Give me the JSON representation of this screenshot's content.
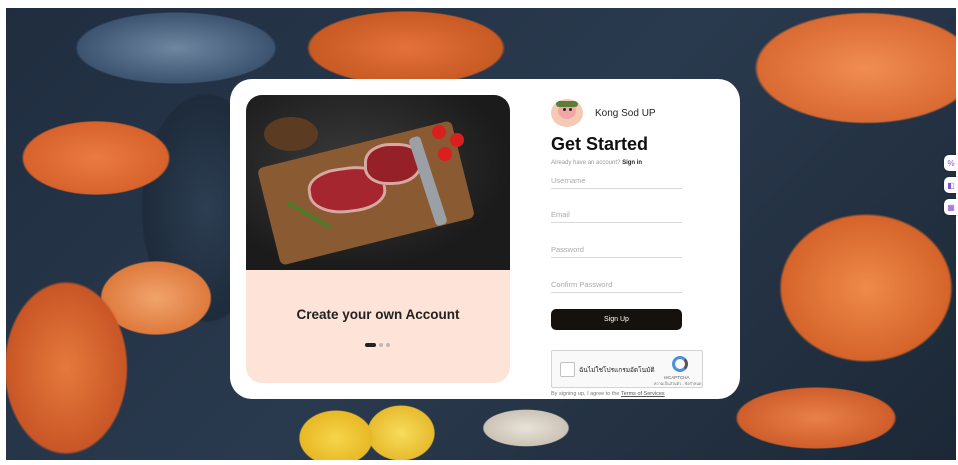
{
  "brand": {
    "name": "Kong Sod UP"
  },
  "slide": {
    "title": "Create your own Account",
    "dot_count": 3,
    "active_dot": 0
  },
  "form": {
    "title": "Get Started",
    "have_account_text": "Already have an account?",
    "sign_in_link": "Sign in",
    "username_placeholder": "Username",
    "email_placeholder": "Email",
    "password_placeholder": "Password",
    "confirm_password_placeholder": "Confirm Password",
    "signup_label": "Sign Up"
  },
  "captcha": {
    "label": "ฉันไม่ใช่โปรแกรมอัตโนมัติ",
    "brand": "reCAPTCHA",
    "links": "ความเป็นส่วนตัว - ข้อกำหนด"
  },
  "terms": {
    "prefix": "By signing up, I agree to the",
    "link": "Terms of Services"
  },
  "side_buttons": [
    {
      "icon": "translate-icon",
      "glyph": "%"
    },
    {
      "icon": "window-icon",
      "glyph": "◧"
    },
    {
      "icon": "grid-icon",
      "glyph": "▦"
    }
  ],
  "colors": {
    "primary_button": "#15110f",
    "slide_panel": "#fde3d8",
    "accent_side": "#8a4fd8"
  }
}
